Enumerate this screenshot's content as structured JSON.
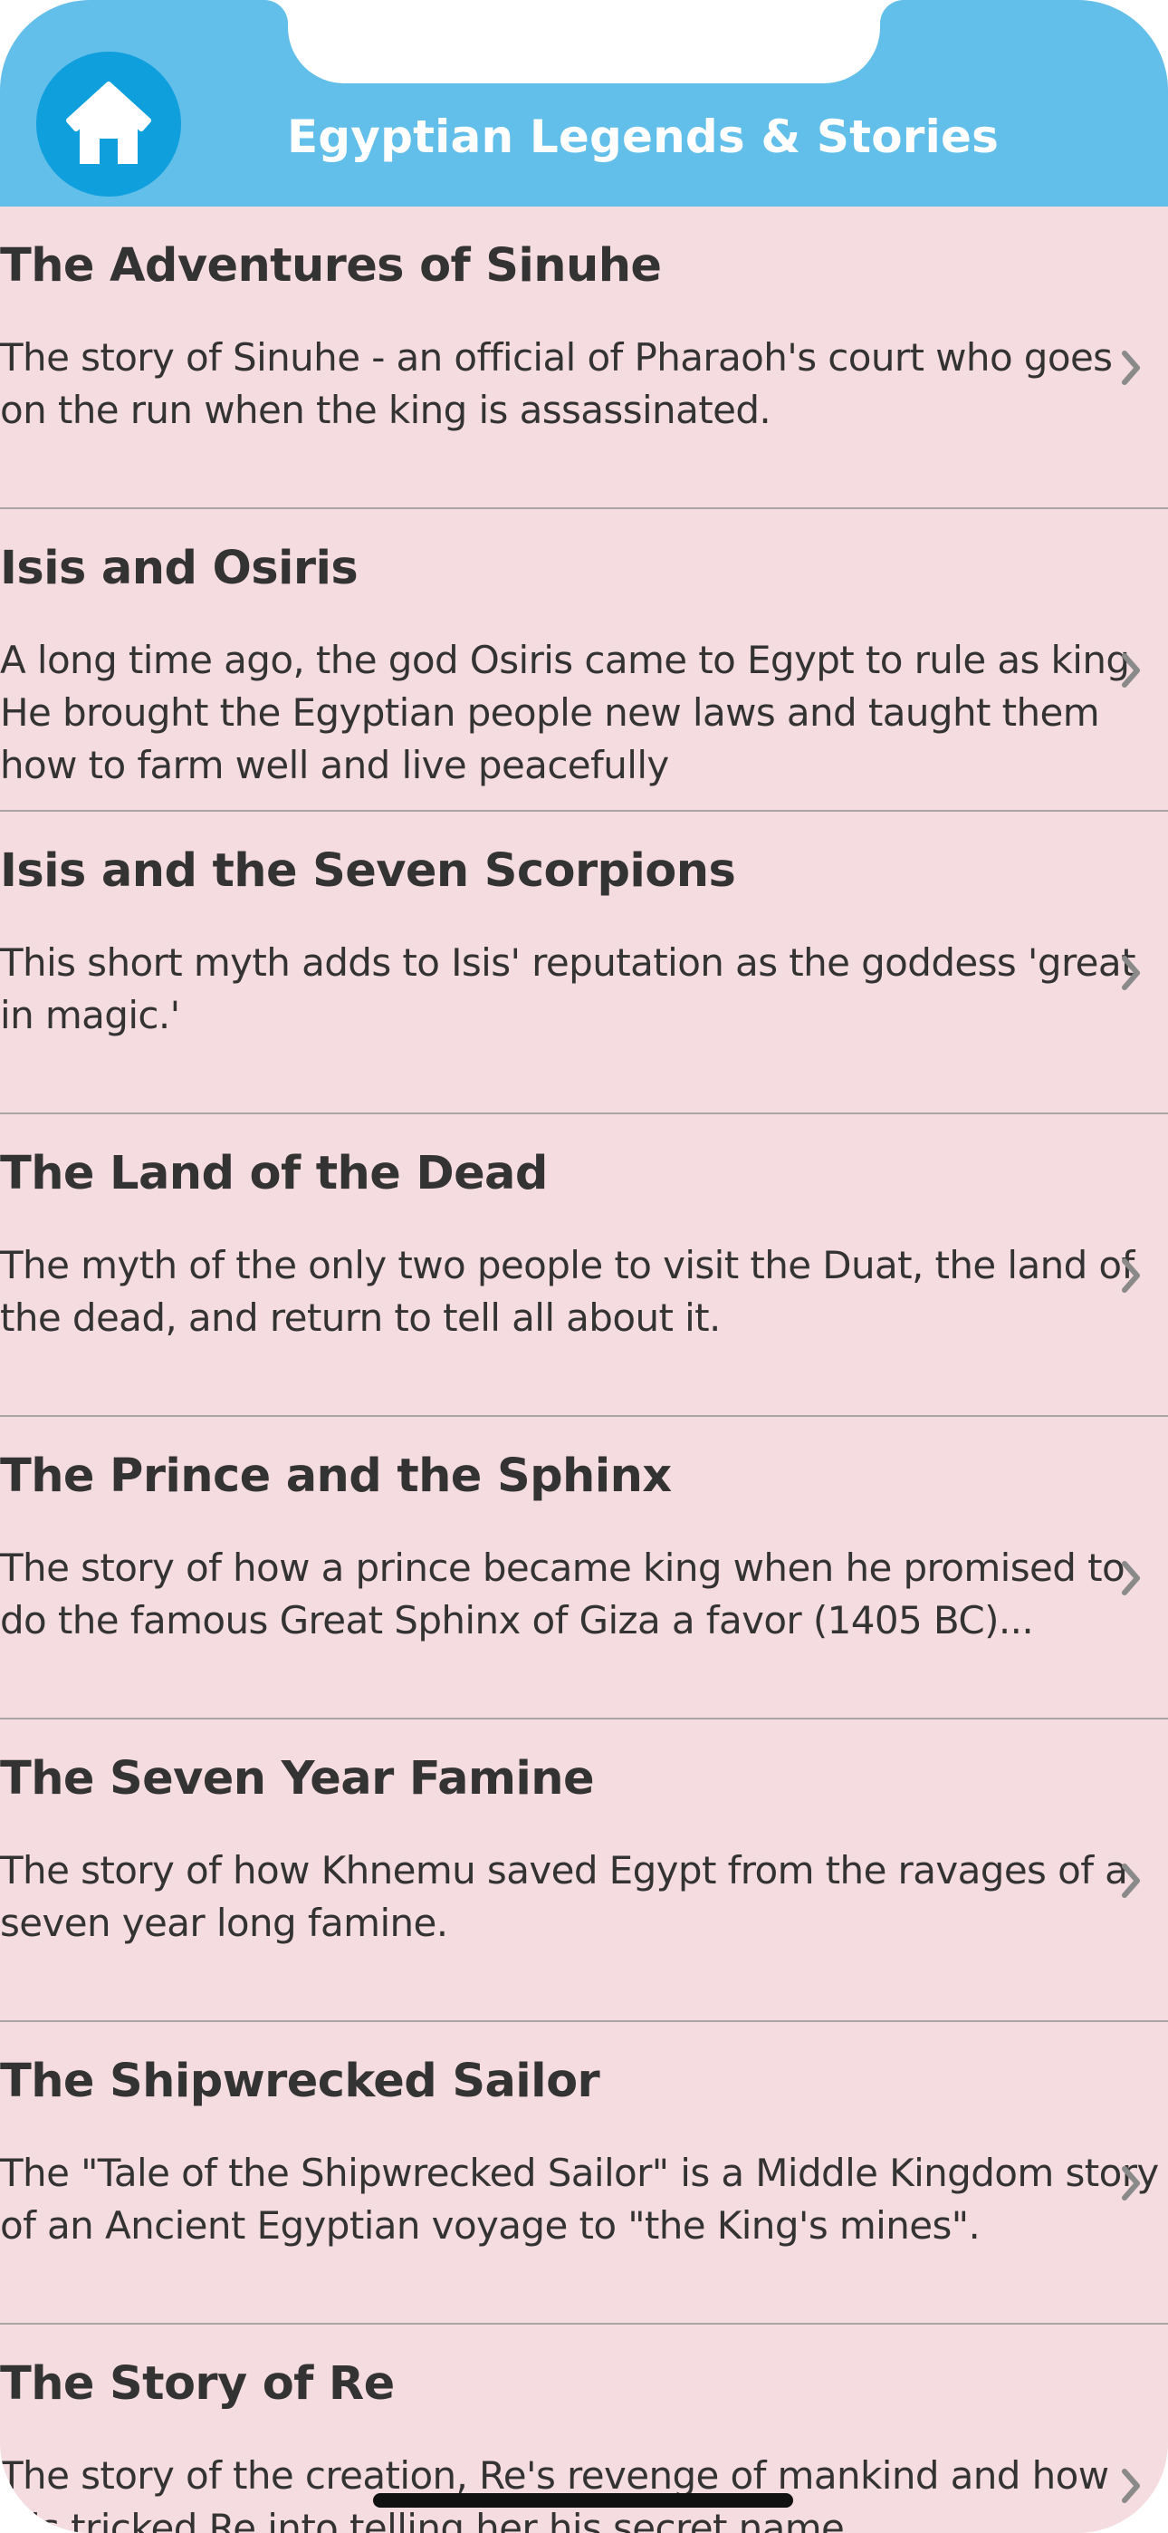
{
  "header": {
    "title": "Egyptian Legends & Stories",
    "home_icon": "home-icon",
    "background": "#62bfea",
    "button_color": "#0f9fdd"
  },
  "stories": [
    {
      "title": "The Adventures of Sinuhe",
      "description": "The story of Sinuhe - an official of Pharaoh's court who goes on the run when the king is assassinated."
    },
    {
      "title": "Isis and Osiris",
      "description": "A long time ago, the god Osiris came to Egypt to rule as king. He brought the Egyptian people new laws and taught them how to farm well and live peacefully"
    },
    {
      "title": "Isis and the Seven Scorpions",
      "description": "This short myth adds to Isis' reputation as the goddess 'great in magic.'"
    },
    {
      "title": "The Land of the Dead",
      "description": "The myth of the only two people to visit the Duat, the land of the dead, and return to tell all about it."
    },
    {
      "title": "The Prince and the Sphinx",
      "description": "The story of how a prince became king when he promised to do the famous Great Sphinx of Giza a favor (1405 BC)..."
    },
    {
      "title": "The Seven Year Famine",
      "description": "The story of how Khnemu saved Egypt from the ravages of a seven year long famine."
    },
    {
      "title": "The Shipwrecked Sailor",
      "description": "The \"Tale of the Shipwrecked Sailor\" is a Middle Kingdom story of an Ancient Egyptian voyage to \"the King's mines\"."
    },
    {
      "title": "The Story of Re",
      "description": "The story of the creation, Re's revenge of mankind and how Isis tricked Re into telling her his secret name."
    }
  ],
  "colors": {
    "list_background": "#f5dce0",
    "text": "#333333",
    "separator": "#a9a5a6",
    "chevron": "#8a8a8a"
  }
}
